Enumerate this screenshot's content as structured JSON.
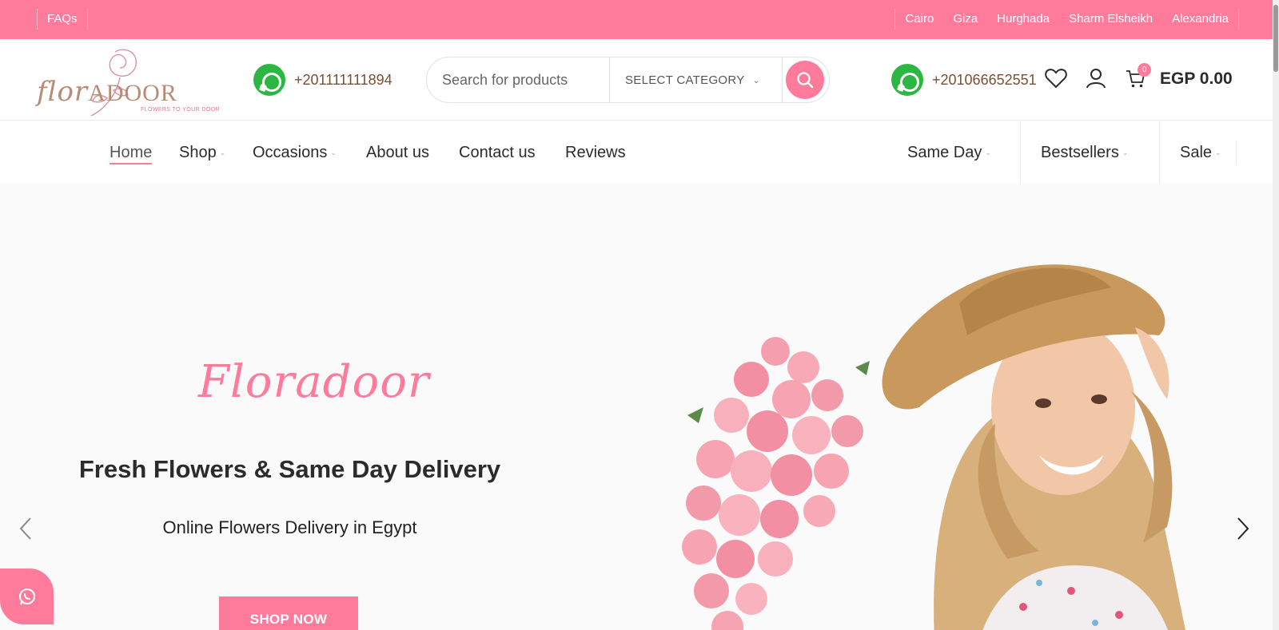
{
  "topbar": {
    "faq_label": "FAQs",
    "cities": [
      "Cairo",
      "Giza",
      "Hurghada",
      "Sharm Elsheikh",
      "Alexandria"
    ]
  },
  "header": {
    "logo": {
      "main_script": "flor",
      "main_caps": "ADOOR",
      "tagline": "FLOWERS TO YOUR DOOR"
    },
    "whatsapp_1": "+201111111894",
    "whatsapp_2": "+201066652551",
    "search": {
      "placeholder": "Search for products",
      "category_label": "SELECT CATEGORY"
    },
    "cart": {
      "count": "0",
      "total": "EGP 0.00"
    }
  },
  "nav": {
    "left": [
      {
        "label": "Home",
        "active": true
      },
      {
        "label": "Shop",
        "dropdown": true
      },
      {
        "label": "Occasions",
        "dropdown": true
      },
      {
        "label": "About us"
      },
      {
        "label": "Contact us"
      },
      {
        "label": "Reviews"
      }
    ],
    "right": [
      {
        "label": "Same Day",
        "dropdown": true
      },
      {
        "label": "Bestsellers",
        "dropdown": true
      },
      {
        "label": "Sale",
        "dropdown": true
      }
    ]
  },
  "hero": {
    "script_title": "Floradoor",
    "title": "Fresh Flowers & Same Day Delivery",
    "subtitle": "Online Flowers Delivery in Egypt",
    "cta_label": "SHOP NOW"
  },
  "colors": {
    "brand_pink": "#ff7b9c",
    "whatsapp_green": "#2bb741",
    "logo_brown": "#b88b74",
    "phone_brown": "#7a4f35"
  },
  "icons": [
    "whatsapp-icon",
    "search-icon",
    "heart-icon",
    "user-icon",
    "cart-icon",
    "chevron-left-icon",
    "chevron-right-icon"
  ]
}
